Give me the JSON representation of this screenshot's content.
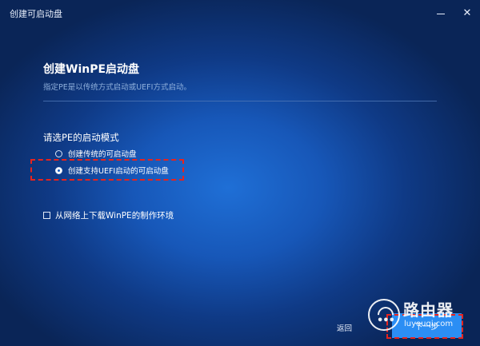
{
  "window": {
    "title": "创建可启动盘",
    "minimize_glyph": "—",
    "close_glyph": "✕"
  },
  "header": {
    "heading": "创建WinPE启动盘",
    "subheading": "指定PE是以传统方式启动或UEFI方式启动。"
  },
  "boot_mode": {
    "label": "请选PE的启动模式",
    "options": [
      {
        "label": "创建传统的可启动盘",
        "selected": false
      },
      {
        "label": "创建支持UEFI启动的可启动盘",
        "selected": true
      }
    ]
  },
  "download_option": {
    "label": "从网络上下载WinPE的制作环境",
    "checked": false
  },
  "footer": {
    "back_label": "返回",
    "next_label": "下一步"
  },
  "watermark": {
    "title": "路由器",
    "url": "luyouqi.com",
    "dots": "•••"
  },
  "colors": {
    "background_center": "#1f6fd6",
    "background_edge": "#0a2557",
    "accent": "#2b8ef4",
    "highlight": "#e8231d",
    "subtext": "#8fb0dc"
  },
  "icons": [
    "minimize-icon",
    "close-icon",
    "radio-icon",
    "checkbox-icon"
  ]
}
